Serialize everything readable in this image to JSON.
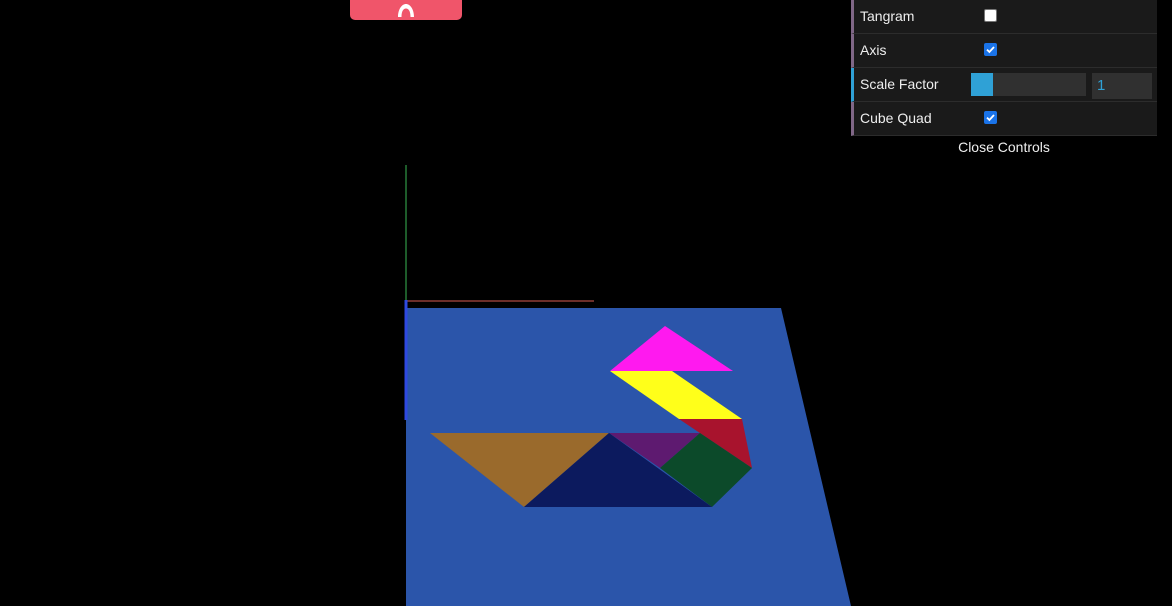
{
  "scene": {
    "background_color": "#000000",
    "ground_plane_color": "#2b55aa",
    "axis_colors": {
      "x": "#c0392b",
      "y": "#27ae60",
      "z": "#2e49e0"
    },
    "tangram_pieces": [
      {
        "name": "pink-triangle",
        "color": "#ff19ef"
      },
      {
        "name": "yellow-parallelogram",
        "color": "#ffff1a"
      },
      {
        "name": "red-triangle",
        "color": "#a8132d"
      },
      {
        "name": "purple-triangle",
        "color": "#5e1a70"
      },
      {
        "name": "green-square",
        "color": "#0c4a2a"
      },
      {
        "name": "brown-triangle",
        "color": "#9a6a2c"
      },
      {
        "name": "navy-triangle",
        "color": "#0c1a5e"
      }
    ]
  },
  "top_tab": {
    "icon": "chevron-up-icon",
    "color": "#f0556a"
  },
  "controls": {
    "tangram": {
      "label": "Tangram",
      "checked": false
    },
    "axis": {
      "label": "Axis",
      "checked": true
    },
    "scale_factor": {
      "label": "Scale Factor",
      "value": "1",
      "fill_fraction": 0.19
    },
    "cube_quad": {
      "label": "Cube Quad",
      "checked": true
    },
    "close_label": "Close Controls"
  }
}
